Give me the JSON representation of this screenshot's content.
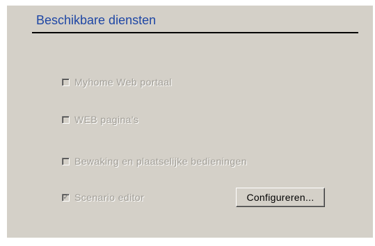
{
  "section": {
    "title": "Beschikbare diensten"
  },
  "services": [
    {
      "label": "Myhome Web portaal",
      "checked": false,
      "enabled": false
    },
    {
      "label": "WEB pagina's",
      "checked": false,
      "enabled": false
    },
    {
      "label": "Bewaking en plaatselijke bedieningen",
      "checked": false,
      "enabled": false
    },
    {
      "label": "Scenario editor",
      "checked": true,
      "enabled": false
    }
  ],
  "buttons": {
    "configure_label": "Configureren..."
  },
  "colors": {
    "panel_bg": "#d4d0c8",
    "title": "#1f47a5",
    "disabled_text": "#a19e97"
  }
}
